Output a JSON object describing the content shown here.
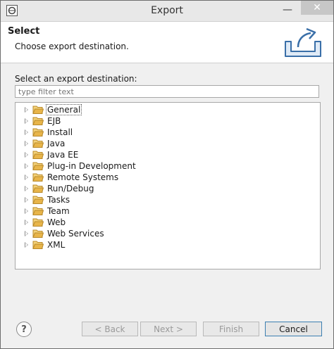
{
  "window": {
    "title": "Export"
  },
  "header": {
    "title": "Select",
    "description": "Choose export destination."
  },
  "filter": {
    "label": "Select an export destination:",
    "placeholder": "type filter text"
  },
  "tree": {
    "items": [
      {
        "label": "General",
        "selected": true
      },
      {
        "label": "EJB"
      },
      {
        "label": "Install"
      },
      {
        "label": "Java"
      },
      {
        "label": "Java EE"
      },
      {
        "label": "Plug-in Development"
      },
      {
        "label": "Remote Systems"
      },
      {
        "label": "Run/Debug"
      },
      {
        "label": "Tasks"
      },
      {
        "label": "Team"
      },
      {
        "label": "Web"
      },
      {
        "label": "Web Services"
      },
      {
        "label": "XML"
      }
    ]
  },
  "buttons": {
    "help": "?",
    "back": "< Back",
    "next": "Next >",
    "finish": "Finish",
    "cancel": "Cancel"
  },
  "colors": {
    "folder": "#e8b54a",
    "accent": "#3c7fb1"
  }
}
